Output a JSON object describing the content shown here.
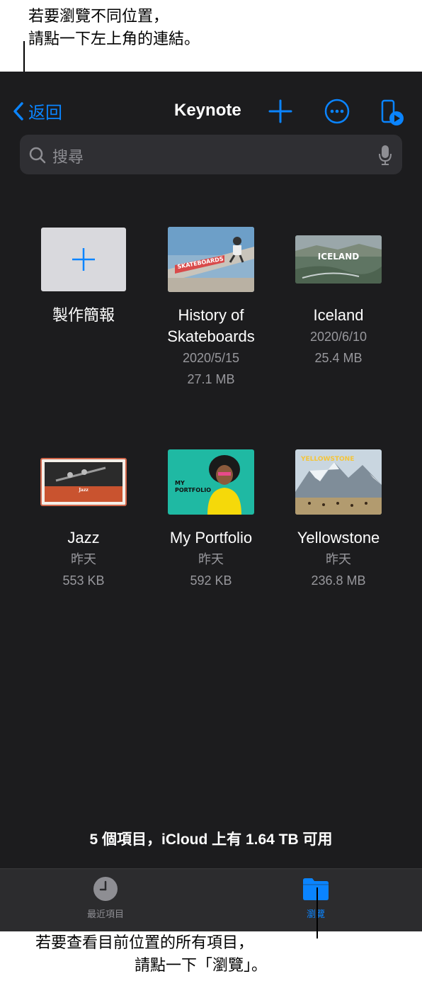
{
  "callouts": {
    "top_line1": "若要瀏覽不同位置，",
    "top_line2": "請點一下左上角的連結。",
    "bottom_line1": "若要查看目前位置的所有項目，",
    "bottom_line2": "請點一下「瀏覽」。"
  },
  "nav": {
    "back_label": "返回",
    "title": "Keynote",
    "icons": [
      "chevron-left-icon",
      "plus-icon",
      "more-icon",
      "play-presentation-icon"
    ]
  },
  "search": {
    "placeholder": "搜尋"
  },
  "create": {
    "label": "製作簡報"
  },
  "files": [
    {
      "name_line1": "History of",
      "name_line2": "Skateboards",
      "date": "2020/5/15",
      "size": "27.1 MB",
      "thumb_text": "SKATEBOARDS"
    },
    {
      "name_line1": "Iceland",
      "name_line2": "",
      "date": "2020/6/10",
      "size": "25.4 MB",
      "thumb_text": "ICELAND"
    },
    {
      "name_line1": "Jazz",
      "name_line2": "",
      "date": "昨天",
      "size": "553 KB",
      "thumb_text": "Jazz"
    },
    {
      "name_line1": "My Portfolio",
      "name_line2": "",
      "date": "昨天",
      "size": "592 KB",
      "thumb_text": "MY PORTFOLIO"
    },
    {
      "name_line1": "Yellowstone",
      "name_line2": "",
      "date": "昨天",
      "size": "236.8 MB",
      "thumb_text": "YELLOWSTONE"
    }
  ],
  "footer": {
    "info": "5 個項目，iCloud 上有 1.64 TB 可用"
  },
  "tabs": {
    "recents": "最近項目",
    "browse": "瀏覽"
  },
  "colors": {
    "accent": "#0a84ff",
    "background": "#1c1c1e",
    "tabbar": "#2c2c2e"
  }
}
